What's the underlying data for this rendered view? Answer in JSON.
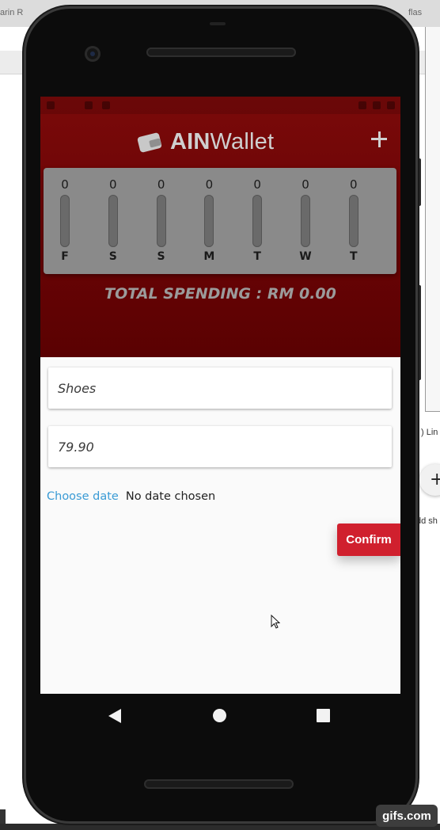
{
  "desktop": {
    "tab_left": "arin R",
    "tab_right": "flas",
    "side_text_1": ") Lin",
    "side_text_2": "dd sh",
    "side_plus": "+"
  },
  "app": {
    "title_bold": "AIN",
    "title_light": "Wallet",
    "accent_color": "#c0151f",
    "header_color": "#6b0405"
  },
  "chart": {
    "days": [
      {
        "label": "F",
        "amount": "0",
        "fill_fraction": 0
      },
      {
        "label": "S",
        "amount": "0",
        "fill_fraction": 0
      },
      {
        "label": "S",
        "amount": "0",
        "fill_fraction": 0
      },
      {
        "label": "M",
        "amount": "0",
        "fill_fraction": 0
      },
      {
        "label": "T",
        "amount": "0",
        "fill_fraction": 0
      },
      {
        "label": "W",
        "amount": "0",
        "fill_fraction": 0
      },
      {
        "label": "T",
        "amount": "0",
        "fill_fraction": 0
      }
    ]
  },
  "total": {
    "text": "TOTAL SPENDING : RM 0.00"
  },
  "form": {
    "name_value": "Shoes",
    "amount_value": "79.90",
    "choose_date_label": "Choose date",
    "no_date_text": "No date chosen",
    "confirm_label": "Confirm"
  },
  "watermark": "gifs.com"
}
